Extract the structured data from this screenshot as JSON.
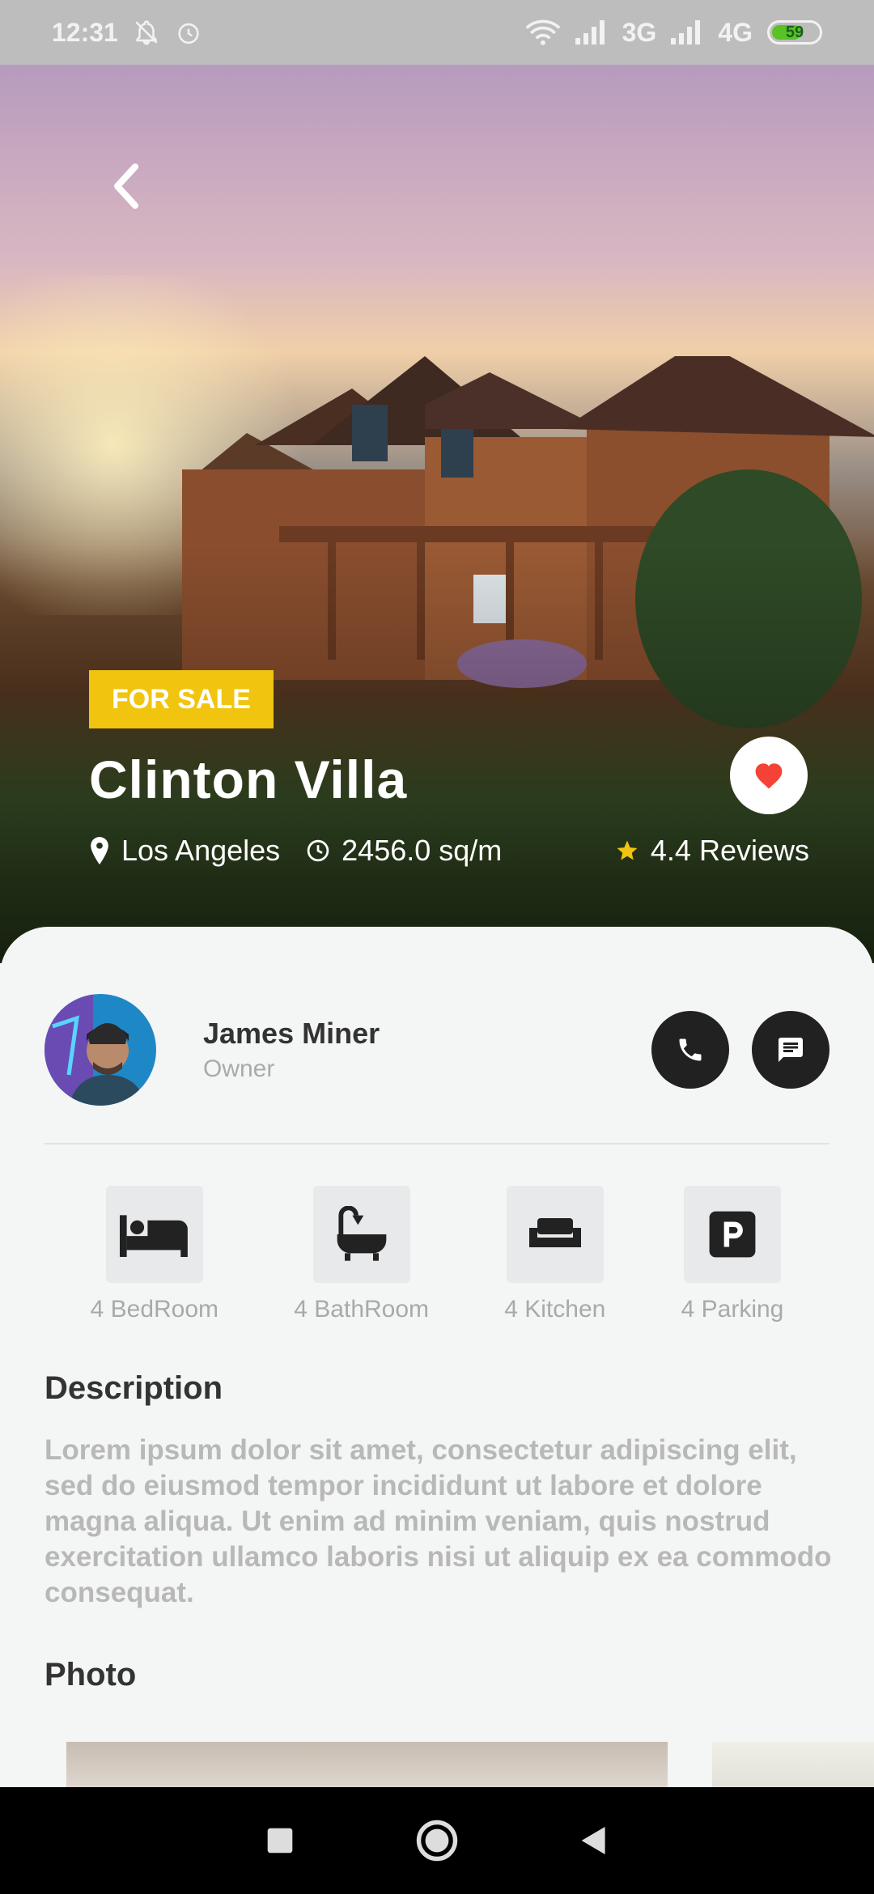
{
  "status_bar": {
    "time": "12:31",
    "network_1": "3G",
    "network_2": "4G",
    "battery": "59",
    "icons": [
      "muted-bell-icon",
      "alarm-icon",
      "wifi-icon",
      "signal-icon",
      "signal-icon",
      "battery-icon"
    ]
  },
  "listing": {
    "badge": "FOR SALE",
    "title": "Clinton Villa",
    "location": "Los Angeles",
    "area": "2456.0 sq/m",
    "rating": "4.4 Reviews"
  },
  "owner": {
    "name": "James Miner",
    "role": "Owner"
  },
  "features": [
    {
      "label": "4 BedRoom",
      "icon": "bed-icon"
    },
    {
      "label": "4 BathRoom",
      "icon": "bathtub-icon"
    },
    {
      "label": "4 Kitchen",
      "icon": "sofa-icon"
    },
    {
      "label": "4 Parking",
      "icon": "parking-icon"
    }
  ],
  "description": {
    "title": "Description",
    "text": "Lorem ipsum dolor sit amet, consectetur adipiscing elit, sed do eiusmod tempor incididunt ut labore et dolore magna aliqua. Ut enim ad minim veniam, quis nostrud exercitation ullamco laboris nisi ut aliquip ex ea commodo consequat."
  },
  "photos": {
    "title": "Photo"
  },
  "colors": {
    "badge": "#f1c40f",
    "heart": "#f44336",
    "star": "#f1c40f",
    "dark_button": "#212121"
  }
}
